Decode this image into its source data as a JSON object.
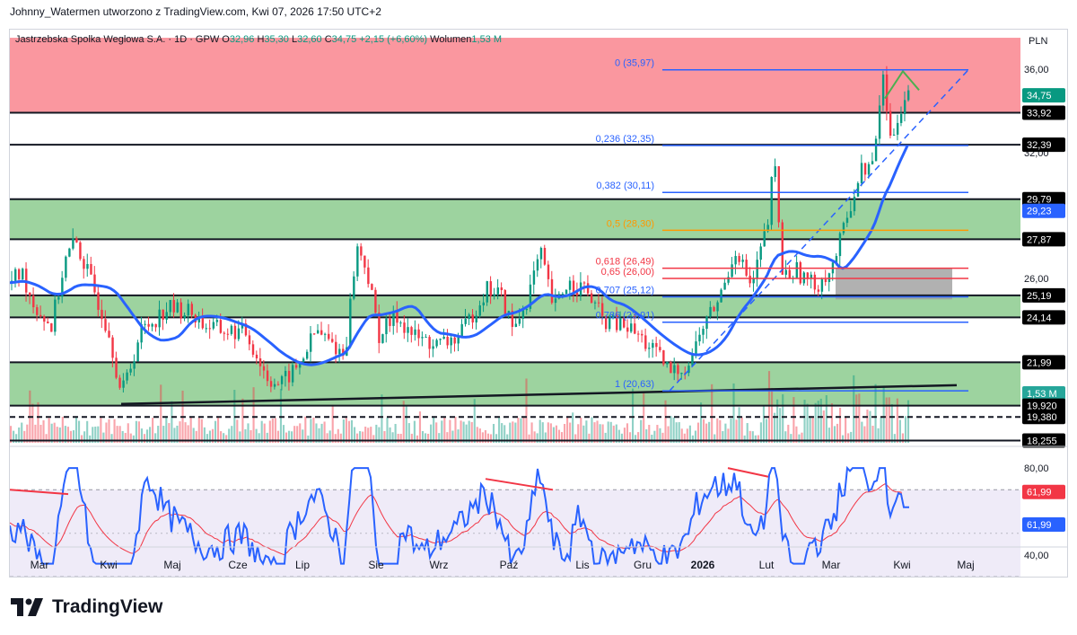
{
  "header": {
    "credit": "Johnny_Watermen utworzono z TradingView.com, Kwi 07, 2026 17:50 UTC+2"
  },
  "legend": {
    "symbol": "Jastrzebska Spolka Weglowa S.A. · 1D · GPW",
    "o_label": "O",
    "o": "32,96",
    "h_label": "H",
    "h": "35,30",
    "l_label": "L",
    "l": "32,60",
    "c_label": "C",
    "c": "34,75",
    "change": "+2,15 (+6,60%)",
    "vol_label": "Wolumen",
    "vol": "1,53 M"
  },
  "currency": "PLN",
  "axis_ticks": [
    "36,00",
    "32,00",
    "28,00",
    "26,00"
  ],
  "rsi_ticks": [
    "80,00",
    "40,00"
  ],
  "price_badges": [
    {
      "text": "34,75",
      "kind": "price"
    },
    {
      "text": "33,92",
      "kind": "level"
    },
    {
      "text": "32,39",
      "kind": "level"
    },
    {
      "text": "29,79",
      "kind": "level"
    },
    {
      "text": "29,23",
      "kind": "ma"
    },
    {
      "text": "27,87",
      "kind": "level"
    },
    {
      "text": "25,19",
      "kind": "level"
    },
    {
      "text": "24,14",
      "kind": "level"
    },
    {
      "text": "21,99",
      "kind": "level"
    },
    {
      "text": "1,53 M",
      "kind": "volume"
    },
    {
      "text": "19,920",
      "kind": "level"
    },
    {
      "text": "19,380",
      "kind": "level"
    },
    {
      "text": "18,255",
      "kind": "level"
    }
  ],
  "rsi_badges": [
    {
      "text": "61,99",
      "kind": "rsi_ma"
    },
    {
      "text": "61,99",
      "kind": "rsi"
    }
  ],
  "fib_labels": [
    {
      "text": "0 (35,97)",
      "color": "#2962ff"
    },
    {
      "text": "0,236 (32,35)",
      "color": "#2962ff"
    },
    {
      "text": "0,382 (30,11)",
      "color": "#2962ff"
    },
    {
      "text": "0,5 (28,30)",
      "color": "#ff9800"
    },
    {
      "text": "0,618 (26,49)",
      "color": "#f23645"
    },
    {
      "text": "0,65 (26,00)",
      "color": "#f23645"
    },
    {
      "text": "0,707 (25,12)",
      "color": "#2962ff"
    },
    {
      "text": "0,786 (23,91)",
      "color": "#2962ff"
    },
    {
      "text": "1 (20,63)",
      "color": "#2962ff"
    }
  ],
  "x_ticks": [
    "Mar",
    "Kwi",
    "Maj",
    "Cze",
    "Lip",
    "Sie",
    "Wrz",
    "Paź",
    "Lis",
    "Gru",
    "2026",
    "Lut",
    "Mar",
    "Kwi",
    "Maj"
  ],
  "footer": {
    "brand": "TradingView"
  },
  "colors": {
    "up": "#089981",
    "down": "#f23645",
    "ma": "#2962ff",
    "rsi": "#2962ff",
    "rsi_ma": "#f23645",
    "fib": "#2962ff",
    "zone_red": "#f7525f",
    "zone_green": "#4caf50"
  },
  "chart_data": {
    "type": "candlestick",
    "y_unit": "PLN",
    "ylim": [
      18.0,
      37.5
    ],
    "current_price": 34.75,
    "horizontal_levels": [
      33.92,
      32.39,
      29.79,
      27.87,
      25.19,
      24.14,
      21.99,
      19.92,
      19.38,
      18.255
    ],
    "zones": [
      {
        "from": 33.92,
        "to": 37.5,
        "color": "red"
      },
      {
        "from": 27.87,
        "to": 29.79,
        "color": "green"
      },
      {
        "from": 24.14,
        "to": 25.19,
        "color": "green"
      },
      {
        "from": 19.92,
        "to": 21.99,
        "color": "green"
      }
    ],
    "fibonacci": [
      {
        "level": 0,
        "price": 35.97
      },
      {
        "level": 0.236,
        "price": 32.35
      },
      {
        "level": 0.382,
        "price": 30.11
      },
      {
        "level": 0.5,
        "price": 28.3
      },
      {
        "level": 0.618,
        "price": 26.49
      },
      {
        "level": 0.65,
        "price": 26.0
      },
      {
        "level": 0.707,
        "price": 25.12
      },
      {
        "level": 0.786,
        "price": 23.91
      },
      {
        "level": 1,
        "price": 20.63
      }
    ],
    "close_series": [
      {
        "x": "2025-03",
        "close": 25.5
      },
      {
        "x": "2025-04",
        "close": 21.5
      },
      {
        "x": "2025-05",
        "close": 24.5
      },
      {
        "x": "2025-06",
        "close": 22.0
      },
      {
        "x": "2025-07",
        "close": 22.5
      },
      {
        "x": "2025-08",
        "close": 24.0
      },
      {
        "x": "2025-09",
        "close": 23.5
      },
      {
        "x": "2025-10",
        "close": 25.5
      },
      {
        "x": "2025-11",
        "close": 24.5
      },
      {
        "x": "2025-12",
        "close": 22.0
      },
      {
        "x": "2026-01",
        "close": 27.5
      },
      {
        "x": "2026-02",
        "close": 25.5
      },
      {
        "x": "2026-03",
        "close": 32.0
      },
      {
        "x": "2026-04",
        "close": 34.75
      }
    ],
    "moving_average_last": 29.23,
    "volume_last": "1,53 M",
    "rsi": {
      "ylim": [
        30,
        85
      ],
      "band": [
        70,
        30
      ],
      "last": 61.99,
      "ma_last": 61.99
    }
  }
}
